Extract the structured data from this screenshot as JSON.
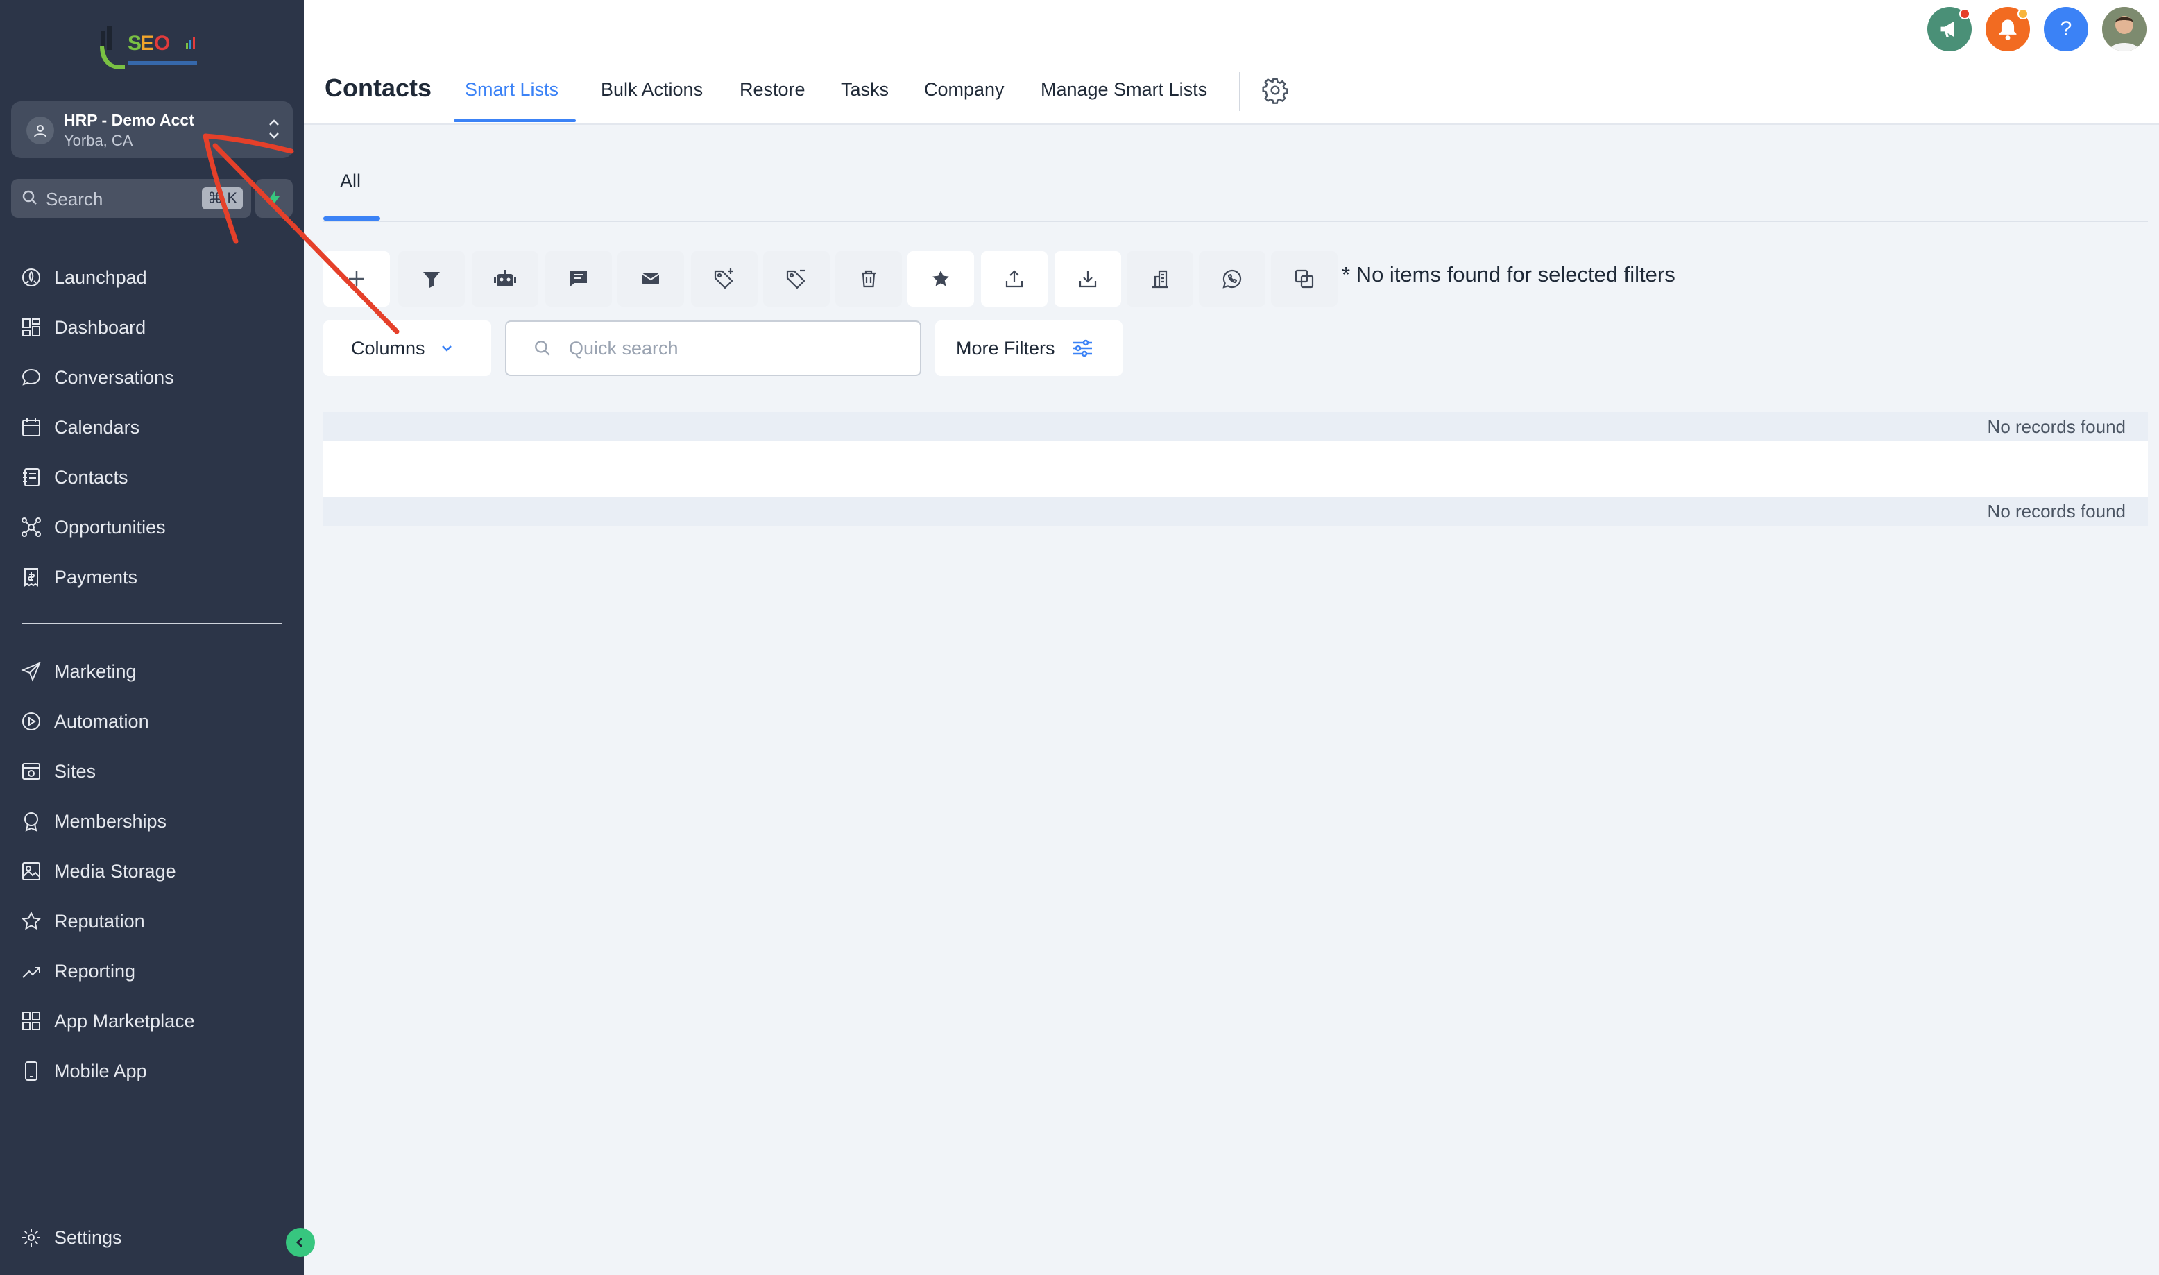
{
  "sidebar": {
    "account": {
      "name": "HRP - Demo Acct",
      "location": "Yorba, CA"
    },
    "search": {
      "placeholder": "Search",
      "shortcut": "⌘ K"
    },
    "nav_main": [
      {
        "label": "Launchpad",
        "icon": "rocket-icon"
      },
      {
        "label": "Dashboard",
        "icon": "grid-icon"
      },
      {
        "label": "Conversations",
        "icon": "chat-bubble-icon"
      },
      {
        "label": "Calendars",
        "icon": "calendar-icon"
      },
      {
        "label": "Contacts",
        "icon": "contact-book-icon"
      },
      {
        "label": "Opportunities",
        "icon": "network-icon"
      },
      {
        "label": "Payments",
        "icon": "receipt-icon"
      }
    ],
    "nav_secondary": [
      {
        "label": "Marketing",
        "icon": "paper-plane-icon"
      },
      {
        "label": "Automation",
        "icon": "play-circle-icon"
      },
      {
        "label": "Sites",
        "icon": "browser-icon"
      },
      {
        "label": "Memberships",
        "icon": "badge-icon"
      },
      {
        "label": "Media Storage",
        "icon": "image-icon"
      },
      {
        "label": "Reputation",
        "icon": "star-icon"
      },
      {
        "label": "Reporting",
        "icon": "trend-icon"
      },
      {
        "label": "App Marketplace",
        "icon": "apps-icon"
      },
      {
        "label": "Mobile App",
        "icon": "phone-icon"
      }
    ],
    "settings_label": "Settings"
  },
  "header": {
    "title": "Contacts",
    "tabs": [
      "Smart Lists",
      "Bulk Actions",
      "Restore",
      "Tasks",
      "Company",
      "Manage Smart Lists"
    ],
    "active_tab": "Smart Lists"
  },
  "content": {
    "subtab": "All",
    "no_items_message": "* No items found for selected filters",
    "columns_label": "Columns",
    "quick_search_placeholder": "Quick search",
    "more_filters_label": "More Filters",
    "no_records": [
      "No records found",
      "No records found"
    ]
  },
  "colors": {
    "sidebar": "#2c3548",
    "accent": "#3b82f6",
    "announce": "#4a9077",
    "notify": "#f26b21",
    "help": "#3b82f6",
    "annotation_arrow": "#e5402a"
  }
}
